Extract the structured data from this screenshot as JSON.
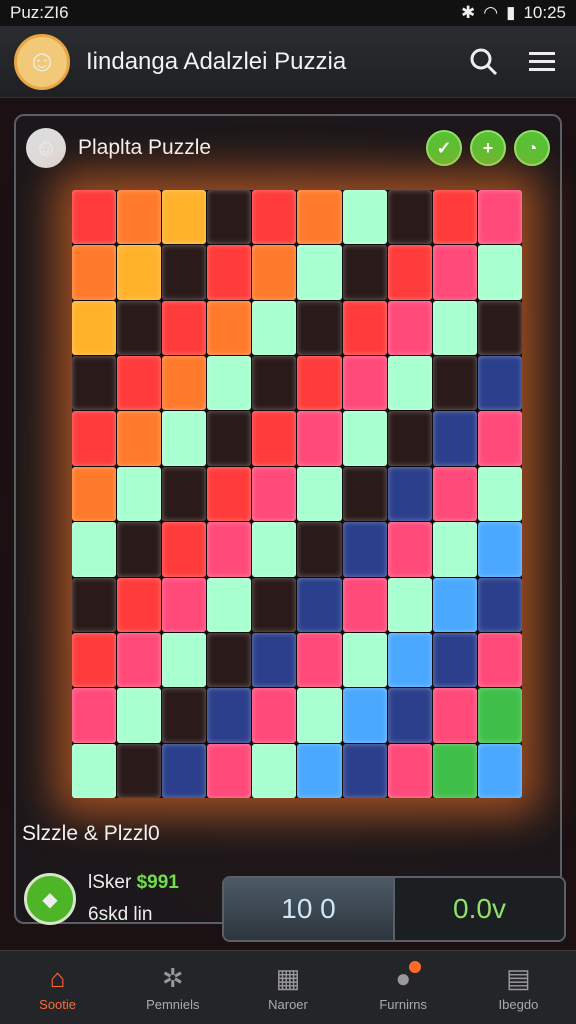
{
  "statusbar": {
    "app": "Puz:ZI6",
    "time": "10:25"
  },
  "appbar": {
    "title": "Iindanga Adalzlei Puzzia"
  },
  "panel": {
    "title": "Plaplta Puzzle"
  },
  "footer": {
    "subtitle": "Slzzle & Plzzl0",
    "stat1_label": "lSker",
    "stat1_value": "$991",
    "stat2": "6skd lin",
    "counter_left": "10 0",
    "counter_right": "0.0v"
  },
  "nav": [
    {
      "label": "Sootie",
      "icon": "home-icon"
    },
    {
      "label": "Pemniels",
      "icon": "bug-icon"
    },
    {
      "label": "Naroer",
      "icon": "grid-icon"
    },
    {
      "label": "Furnirns",
      "icon": "chat-icon"
    },
    {
      "label": "Ibegdo",
      "icon": "book-icon"
    }
  ],
  "colors": {
    "accent": "#ff6a3a",
    "green": "#57c234"
  }
}
